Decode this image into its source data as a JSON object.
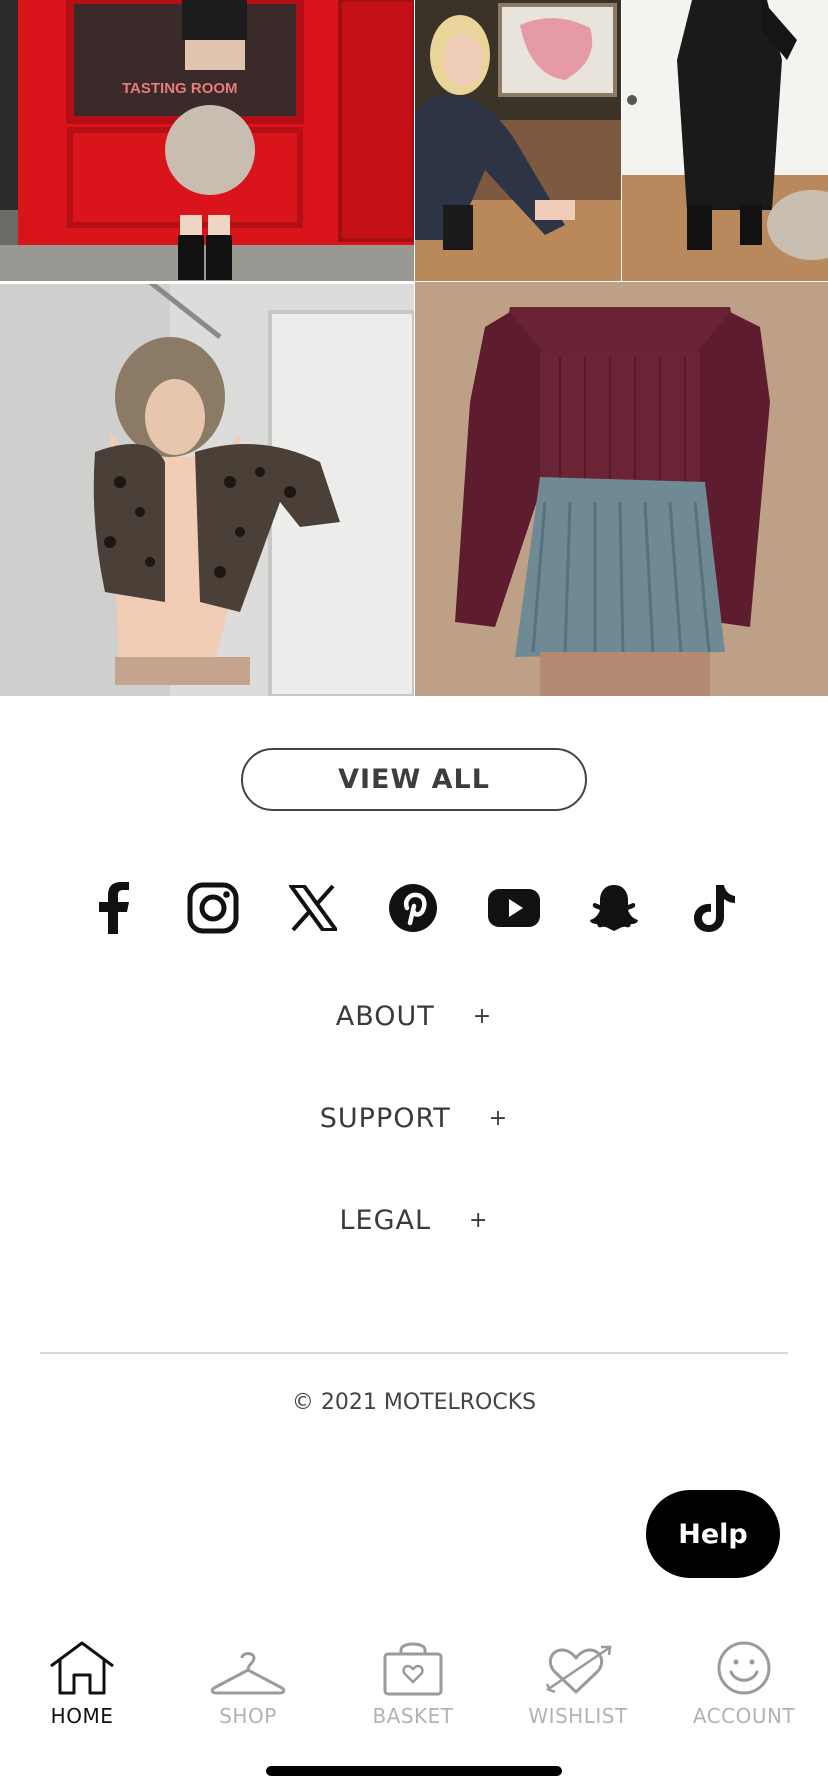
{
  "gallery": {
    "photos": [
      {
        "name": "photo-red-door-skirt",
        "shop_sign": "TASTING ROOM"
      },
      {
        "name": "photo-lace-dress-crouching"
      },
      {
        "name": "photo-black-maxi-dress"
      },
      {
        "name": "photo-leopard-cardigan"
      },
      {
        "name": "photo-burgundy-knit-pleated-skirt"
      }
    ]
  },
  "view_all_label": "VIEW ALL",
  "social": [
    {
      "icon": "facebook-icon"
    },
    {
      "icon": "instagram-icon"
    },
    {
      "icon": "x-icon"
    },
    {
      "icon": "pinterest-icon"
    },
    {
      "icon": "youtube-icon"
    },
    {
      "icon": "snapchat-icon"
    },
    {
      "icon": "tiktok-icon"
    }
  ],
  "footer": {
    "sections": [
      {
        "label": "ABOUT",
        "toggle": "+"
      },
      {
        "label": "SUPPORT",
        "toggle": "+"
      },
      {
        "label": "LEGAL",
        "toggle": "+"
      }
    ],
    "copyright": "© 2021 MOTELROCKS"
  },
  "help_label": "Help",
  "bottom_nav": {
    "items": [
      {
        "label": "HOME",
        "icon": "home-icon",
        "active": true
      },
      {
        "label": "SHOP",
        "icon": "hanger-icon",
        "active": false
      },
      {
        "label": "BASKET",
        "icon": "bag-icon",
        "active": false
      },
      {
        "label": "WISHLIST",
        "icon": "heart-arrow-icon",
        "active": false
      },
      {
        "label": "ACCOUNT",
        "icon": "smiley-icon",
        "active": false
      }
    ]
  },
  "colors": {
    "background": "#ffffff",
    "text": "#3a3a3a",
    "help_bg": "#000000",
    "nav_inactive": "#b3b3b3",
    "nav_active": "#111111"
  }
}
